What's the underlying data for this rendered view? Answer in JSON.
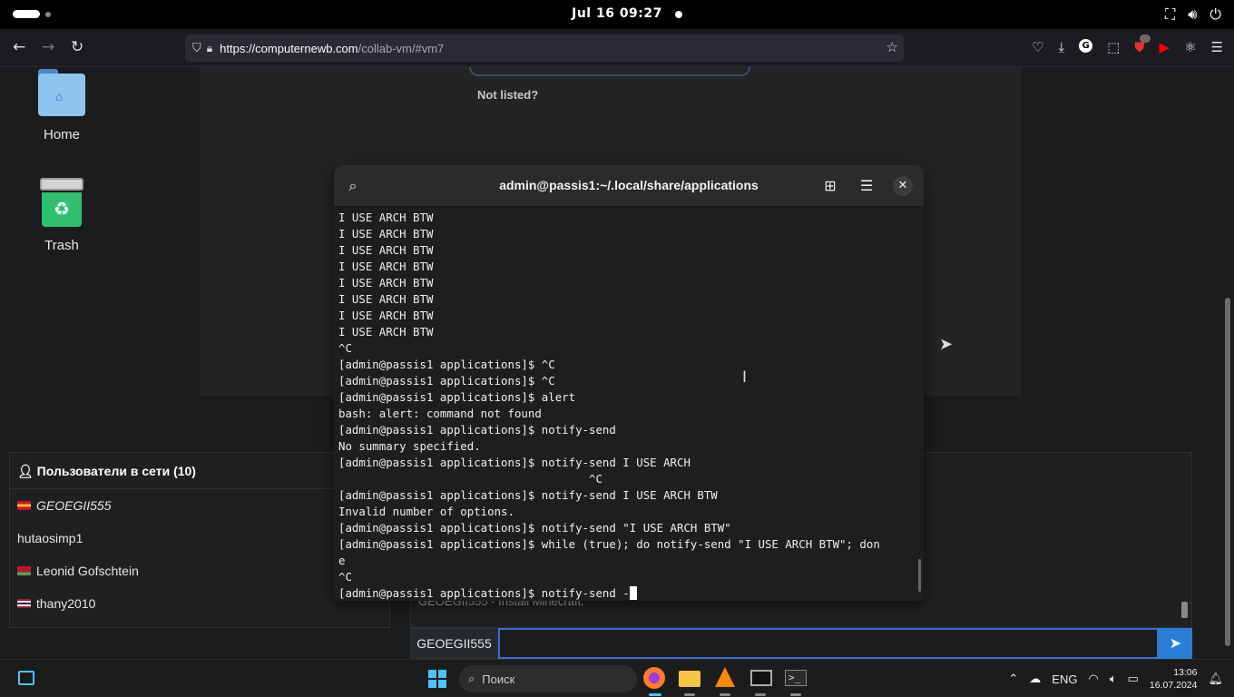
{
  "gnome_topbar": {
    "clock": "Jul 16  09:27",
    "network_icon": "network-icon",
    "volume_icon": "volume-icon",
    "power_icon": "power-icon"
  },
  "browser": {
    "url_host": "https://computernewb.com",
    "url_path": "/collab-vm/#vm7",
    "extension_badge": "2"
  },
  "vm": {
    "not_listed": "Not listed?",
    "desktop_icons": [
      "Home",
      "Trash"
    ]
  },
  "terminal": {
    "title": "admin@passis1:~/.local/share/applications",
    "lines": [
      "I USE ARCH BTW",
      "I USE ARCH BTW",
      "I USE ARCH BTW",
      "I USE ARCH BTW",
      "I USE ARCH BTW",
      "I USE ARCH BTW",
      "I USE ARCH BTW",
      "I USE ARCH BTW",
      "^C",
      "[admin@passis1 applications]$ ^C",
      "[admin@passis1 applications]$ ^C",
      "[admin@passis1 applications]$ alert",
      "bash: alert: command not found",
      "[admin@passis1 applications]$ notify-send",
      "No summary specified.",
      "[admin@passis1 applications]$ notify-send I USE ARCH",
      "                                     ^C",
      "[admin@passis1 applications]$ notify-send I USE ARCH BTW",
      "Invalid number of options.",
      "[admin@passis1 applications]$ notify-send \"I USE ARCH BTW\"",
      "[admin@passis1 applications]$ while (true); do notify-send \"I USE ARCH BTW\"; don",
      "e",
      "^C"
    ],
    "current_line": "[admin@passis1 applications]$ notify-send -"
  },
  "users_panel": {
    "header": "Пользователи в сети (10)",
    "users": [
      {
        "name": "GEOEGII555",
        "flag_colors": [
          "#c8102e",
          "#f0c020"
        ],
        "italic": true
      },
      {
        "name": "hutaosimp1",
        "flag_colors": [],
        "italic": false
      },
      {
        "name": "Leonid Gofschtein",
        "flag_colors": [
          "#c8102e",
          "#4aa657"
        ],
        "italic": false
      },
      {
        "name": "thany2010",
        "flag_colors": [
          "#a51931",
          "#f4f5f8",
          "#2d2a4a"
        ],
        "italic": false
      }
    ]
  },
  "chat": {
    "last_message": "GEOEGII555 - Install Minecraft.",
    "username": "GEOEGII555",
    "input_value": "",
    "send_icon": "send-icon"
  },
  "taskbar": {
    "search_placeholder": "Поиск",
    "language": "ENG",
    "time": "13:06",
    "date": "16.07.2024"
  }
}
